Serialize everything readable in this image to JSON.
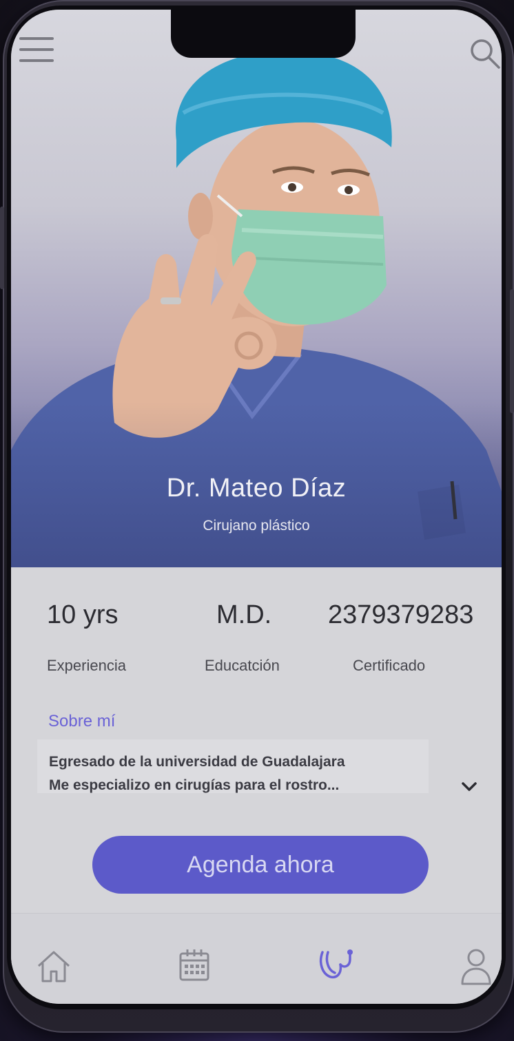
{
  "header": {
    "menu_icon": "hamburger-menu-icon",
    "search_icon": "search-icon"
  },
  "doctor": {
    "name": "Dr. Mateo Díaz",
    "role": "Cirujano plástico",
    "photo": "surgeon-portrait-ok-gesture"
  },
  "stats": [
    {
      "value": "10 yrs",
      "label": "Experiencia"
    },
    {
      "value": "M.D.",
      "label": "Educatción"
    },
    {
      "value": "2379379283",
      "label": "Certificado"
    }
  ],
  "about": {
    "title": "Sobre mí",
    "lines": [
      "Egresado de la universidad de Guadalajara",
      "Me especializo en cirugías para el rostro..."
    ],
    "expand_icon": "chevron-down-icon"
  },
  "cta": {
    "label": "Agenda ahora"
  },
  "tabs": [
    {
      "icon": "home-icon",
      "active": false
    },
    {
      "icon": "calendar-icon",
      "active": false
    },
    {
      "icon": "stethoscope-icon",
      "active": true
    },
    {
      "icon": "profile-icon",
      "active": false
    }
  ],
  "colors": {
    "accent": "#6a62d6",
    "button": "#5c5ac9",
    "screen_bg": "#d5d5d9"
  }
}
